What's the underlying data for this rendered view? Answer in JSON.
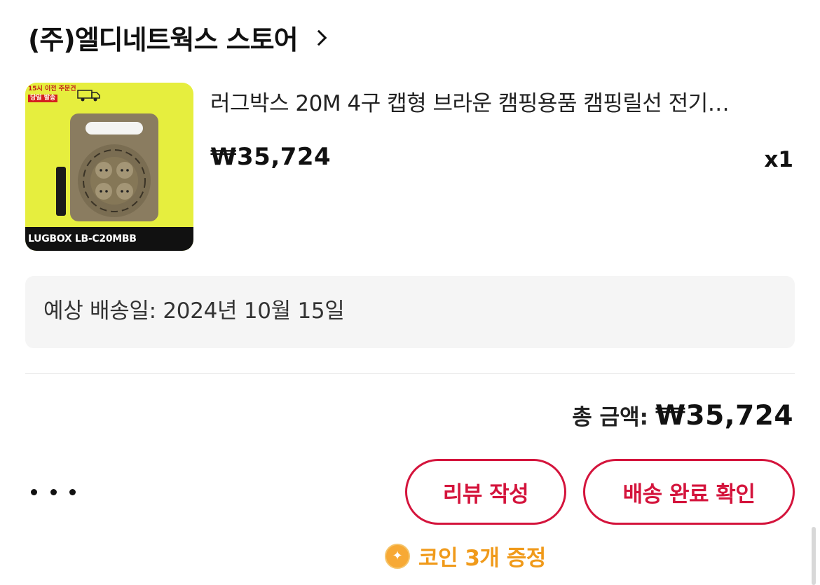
{
  "store": {
    "name": "(주)엘디네트웍스 스토어"
  },
  "product": {
    "image": {
      "badge_line1": "15시 이전 주문건",
      "badge_line2": "당일 발송",
      "caption": "LUGBOX LB-C20MBB"
    },
    "title": "러그박스 20M 4구 캡형 브라운 캠핑용품 캠핑릴선 전기…",
    "price": "₩35,724",
    "quantity": "x1"
  },
  "delivery": {
    "text": "예상 배송일: 2024년 10월 15일"
  },
  "total": {
    "label": "총 금액:",
    "amount": "₩35,724"
  },
  "actions": {
    "review_label": "리뷰 작성",
    "confirm_label": "배송 완료 확인"
  },
  "coin": {
    "text": "코인 3개 증정"
  },
  "colors": {
    "accent": "#d4143c",
    "coin": "#f09a1a",
    "image_background": "#e6ee3e"
  }
}
